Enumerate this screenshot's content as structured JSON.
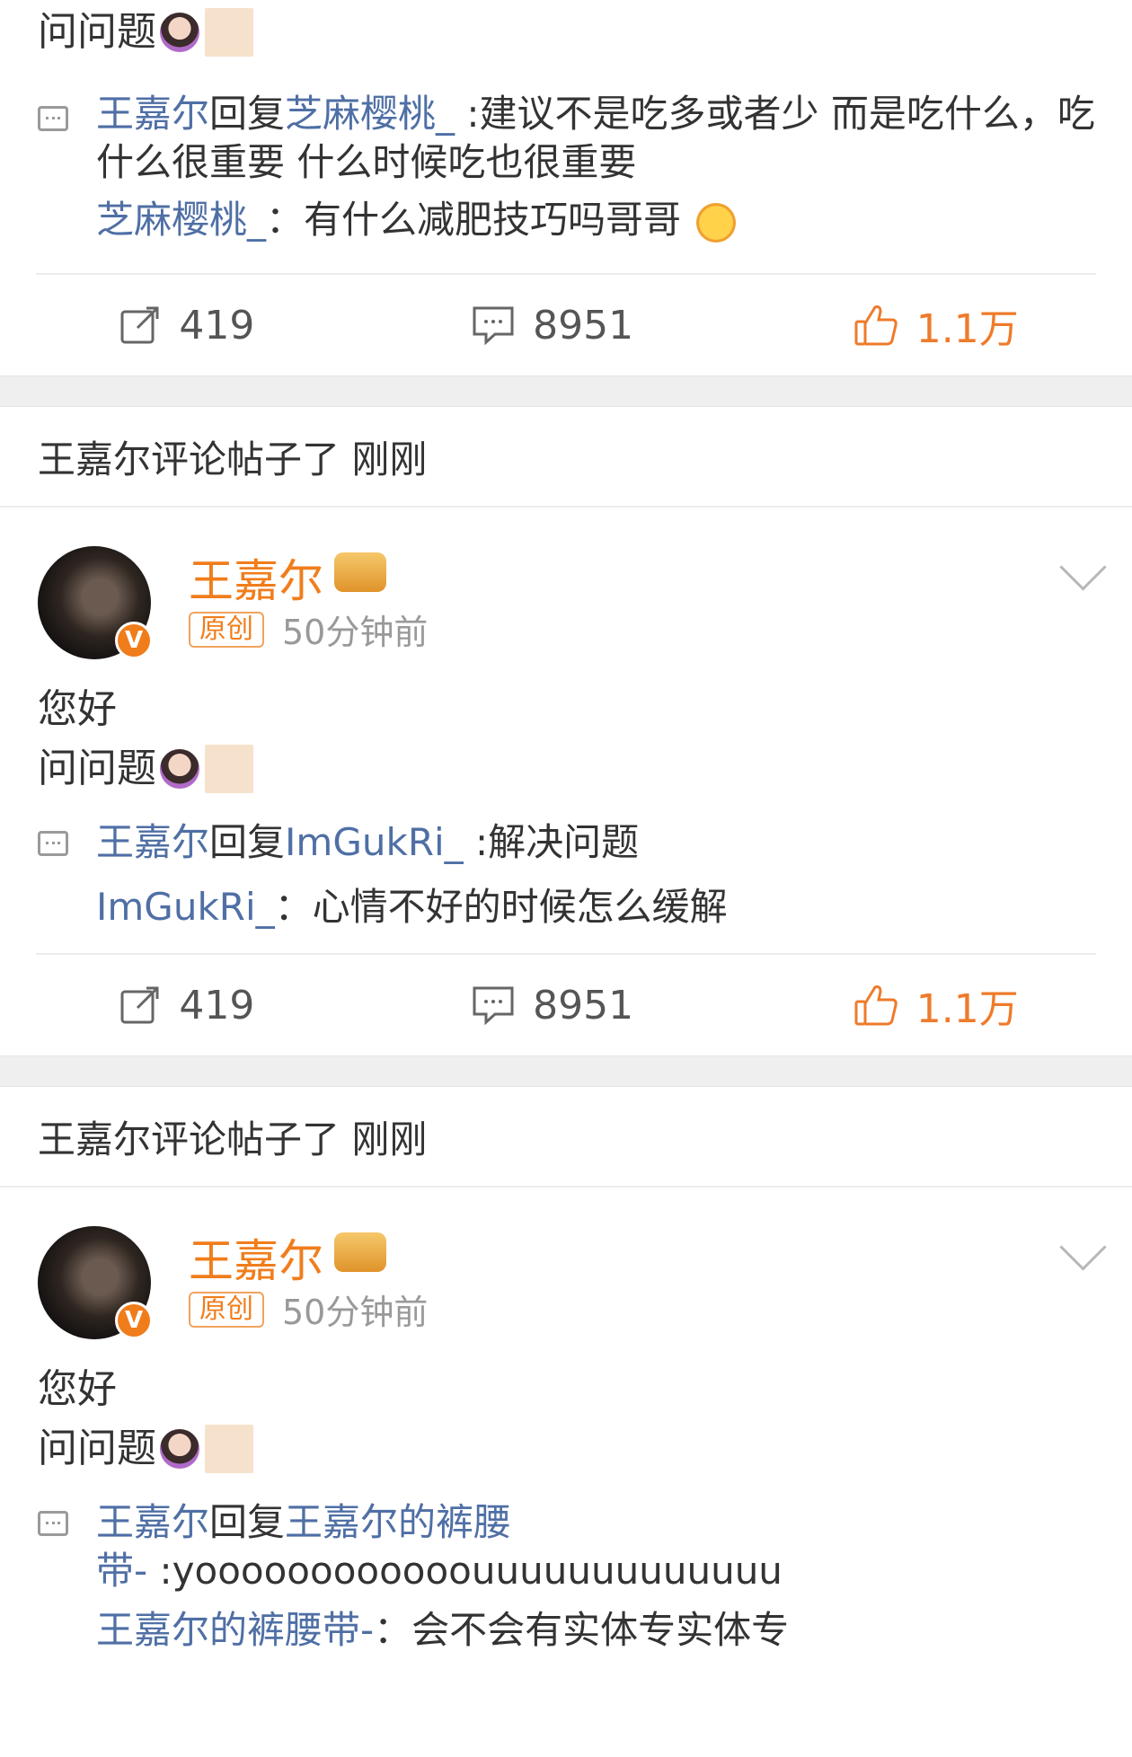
{
  "top_snippet": {
    "post_line": "问问题",
    "reply": {
      "author": "王嘉尔",
      "verb": "回复",
      "target": "芝麻樱桃_",
      "text": ":建议不是吃多或者少 而是吃什么，吃什么很重要 什么时候吃也很重要"
    },
    "quote": {
      "author": "芝麻樱桃_",
      "sep": "：",
      "text": "有什么减肥技巧吗哥哥"
    },
    "actions": {
      "forwards": "419",
      "comments": "8951",
      "likes": "1.1万"
    }
  },
  "events": [
    {
      "event_text": "王嘉尔评论帖子了 刚刚",
      "user_name": "王嘉尔",
      "badge": "V",
      "tag": "原创",
      "time": "50分钟前",
      "body_line1": "您好",
      "body_line2": "问问题",
      "reply": {
        "author": "王嘉尔",
        "verb": "回复",
        "target": "ImGukRi_",
        "text": ":解决问题"
      },
      "quote": {
        "author": "ImGukRi_",
        "sep": "：",
        "text": "心情不好的时候怎么缓解"
      },
      "actions": {
        "forwards": "419",
        "comments": "8951",
        "likes": "1.1万"
      }
    },
    {
      "event_text": "王嘉尔评论帖子了 刚刚",
      "user_name": "王嘉尔",
      "badge": "V",
      "tag": "原创",
      "time": "50分钟前",
      "body_line1": "您好",
      "body_line2": "问问题",
      "reply": {
        "author": "王嘉尔",
        "verb": "回复",
        "target_line1": "王嘉尔的裤腰",
        "target_line2": "带-",
        "text": ":yoooooooooooouuuuuuuuuuuuu"
      },
      "quote": {
        "author": "王嘉尔的裤腰带-",
        "sep": "：",
        "text": "会不会有实体专实体专"
      }
    }
  ],
  "colors": {
    "link": "#4f6fa5",
    "accent": "#f07d1b",
    "gap": "#efefef"
  },
  "icons": [
    "reply-icon",
    "forward-icon",
    "comment-icon",
    "like-icon",
    "crown-icon",
    "chevron-down-icon",
    "verified-icon"
  ]
}
